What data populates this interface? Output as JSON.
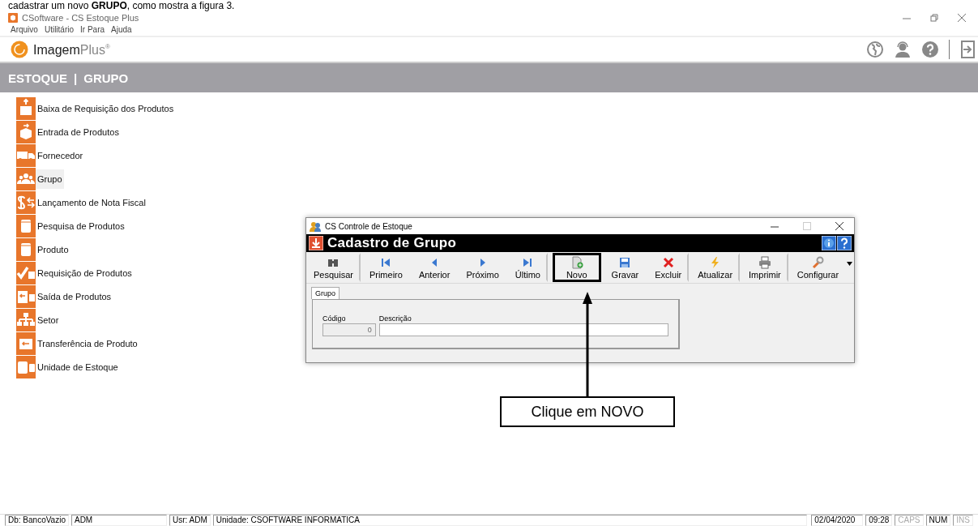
{
  "document_caption": "cadastrar um novo **GRUPO**, como mostra a figura 3.",
  "window": {
    "title": "CSoftware - CS Estoque Plus"
  },
  "menu": [
    "Arquivo",
    "Utilitário",
    "Ir Para",
    "Ajuda"
  ],
  "brand": {
    "name": "Imagem",
    "suffix": "Plus",
    "mark": "®"
  },
  "breadcrumb": {
    "section": "ESTOQUE",
    "separator": "|",
    "page": "GRUPO"
  },
  "sidebar": {
    "items": [
      {
        "label": "Baixa de Requisição dos Produtos",
        "selected": false
      },
      {
        "label": "Entrada de Produtos",
        "selected": false
      },
      {
        "label": "Fornecedor",
        "selected": false
      },
      {
        "label": "Grupo",
        "selected": true
      },
      {
        "label": "Lançamento de Nota Fiscal",
        "selected": false
      },
      {
        "label": "Pesquisa de Produtos",
        "selected": false
      },
      {
        "label": "Produto",
        "selected": false
      },
      {
        "label": "Requisição de Produtos",
        "selected": false
      },
      {
        "label": "Saída de Produtos",
        "selected": false
      },
      {
        "label": "Setor",
        "selected": false
      },
      {
        "label": "Transferência de Produto",
        "selected": false
      },
      {
        "label": "Unidade de Estoque",
        "selected": false
      }
    ]
  },
  "dialog": {
    "title": "CS Controle de Estoque",
    "heading": "Cadastro de Grupo",
    "toolbar": [
      {
        "label": "Pesquisar",
        "separator_after": true,
        "highlighted": false
      },
      {
        "label": "Primeiro",
        "separator_after": false,
        "highlighted": false
      },
      {
        "label": "Anterior",
        "separator_after": false,
        "highlighted": false
      },
      {
        "label": "Próximo",
        "separator_after": false,
        "highlighted": false
      },
      {
        "label": "Último",
        "separator_after": true,
        "highlighted": false
      },
      {
        "label": "Novo",
        "separator_after": false,
        "highlighted": true
      },
      {
        "label": "Gravar",
        "separator_after": false,
        "highlighted": false
      },
      {
        "label": "Excluir",
        "separator_after": true,
        "highlighted": false
      },
      {
        "label": "Atualizar",
        "separator_after": true,
        "highlighted": false
      },
      {
        "label": "Imprimir",
        "separator_after": true,
        "highlighted": false
      },
      {
        "label": "Configurar",
        "separator_after": false,
        "highlighted": false
      }
    ],
    "tabs": [
      {
        "label": "Grupo",
        "selected": true
      }
    ],
    "fields": [
      {
        "label": "Código",
        "value": "0",
        "disabled": true
      },
      {
        "label": "Descrição",
        "disabled": false
      }
    ]
  },
  "annotation": {
    "text": "Clique em NOVO"
  },
  "status_bar": [
    {
      "text": "Db: BancoVazio",
      "on": true
    },
    {
      "text": "ADM",
      "on": true
    },
    {
      "text": "Usr: ADM",
      "on": true
    },
    {
      "text": "Unidade: CSOFTWARE INFORMATICA",
      "on": true
    },
    {
      "text": "02/04/2020",
      "on": true
    },
    {
      "text": "09:28",
      "on": true
    },
    {
      "text": "CAPS",
      "on": false
    },
    {
      "text": "NUM",
      "on": true
    },
    {
      "text": "INS",
      "on": false
    }
  ]
}
